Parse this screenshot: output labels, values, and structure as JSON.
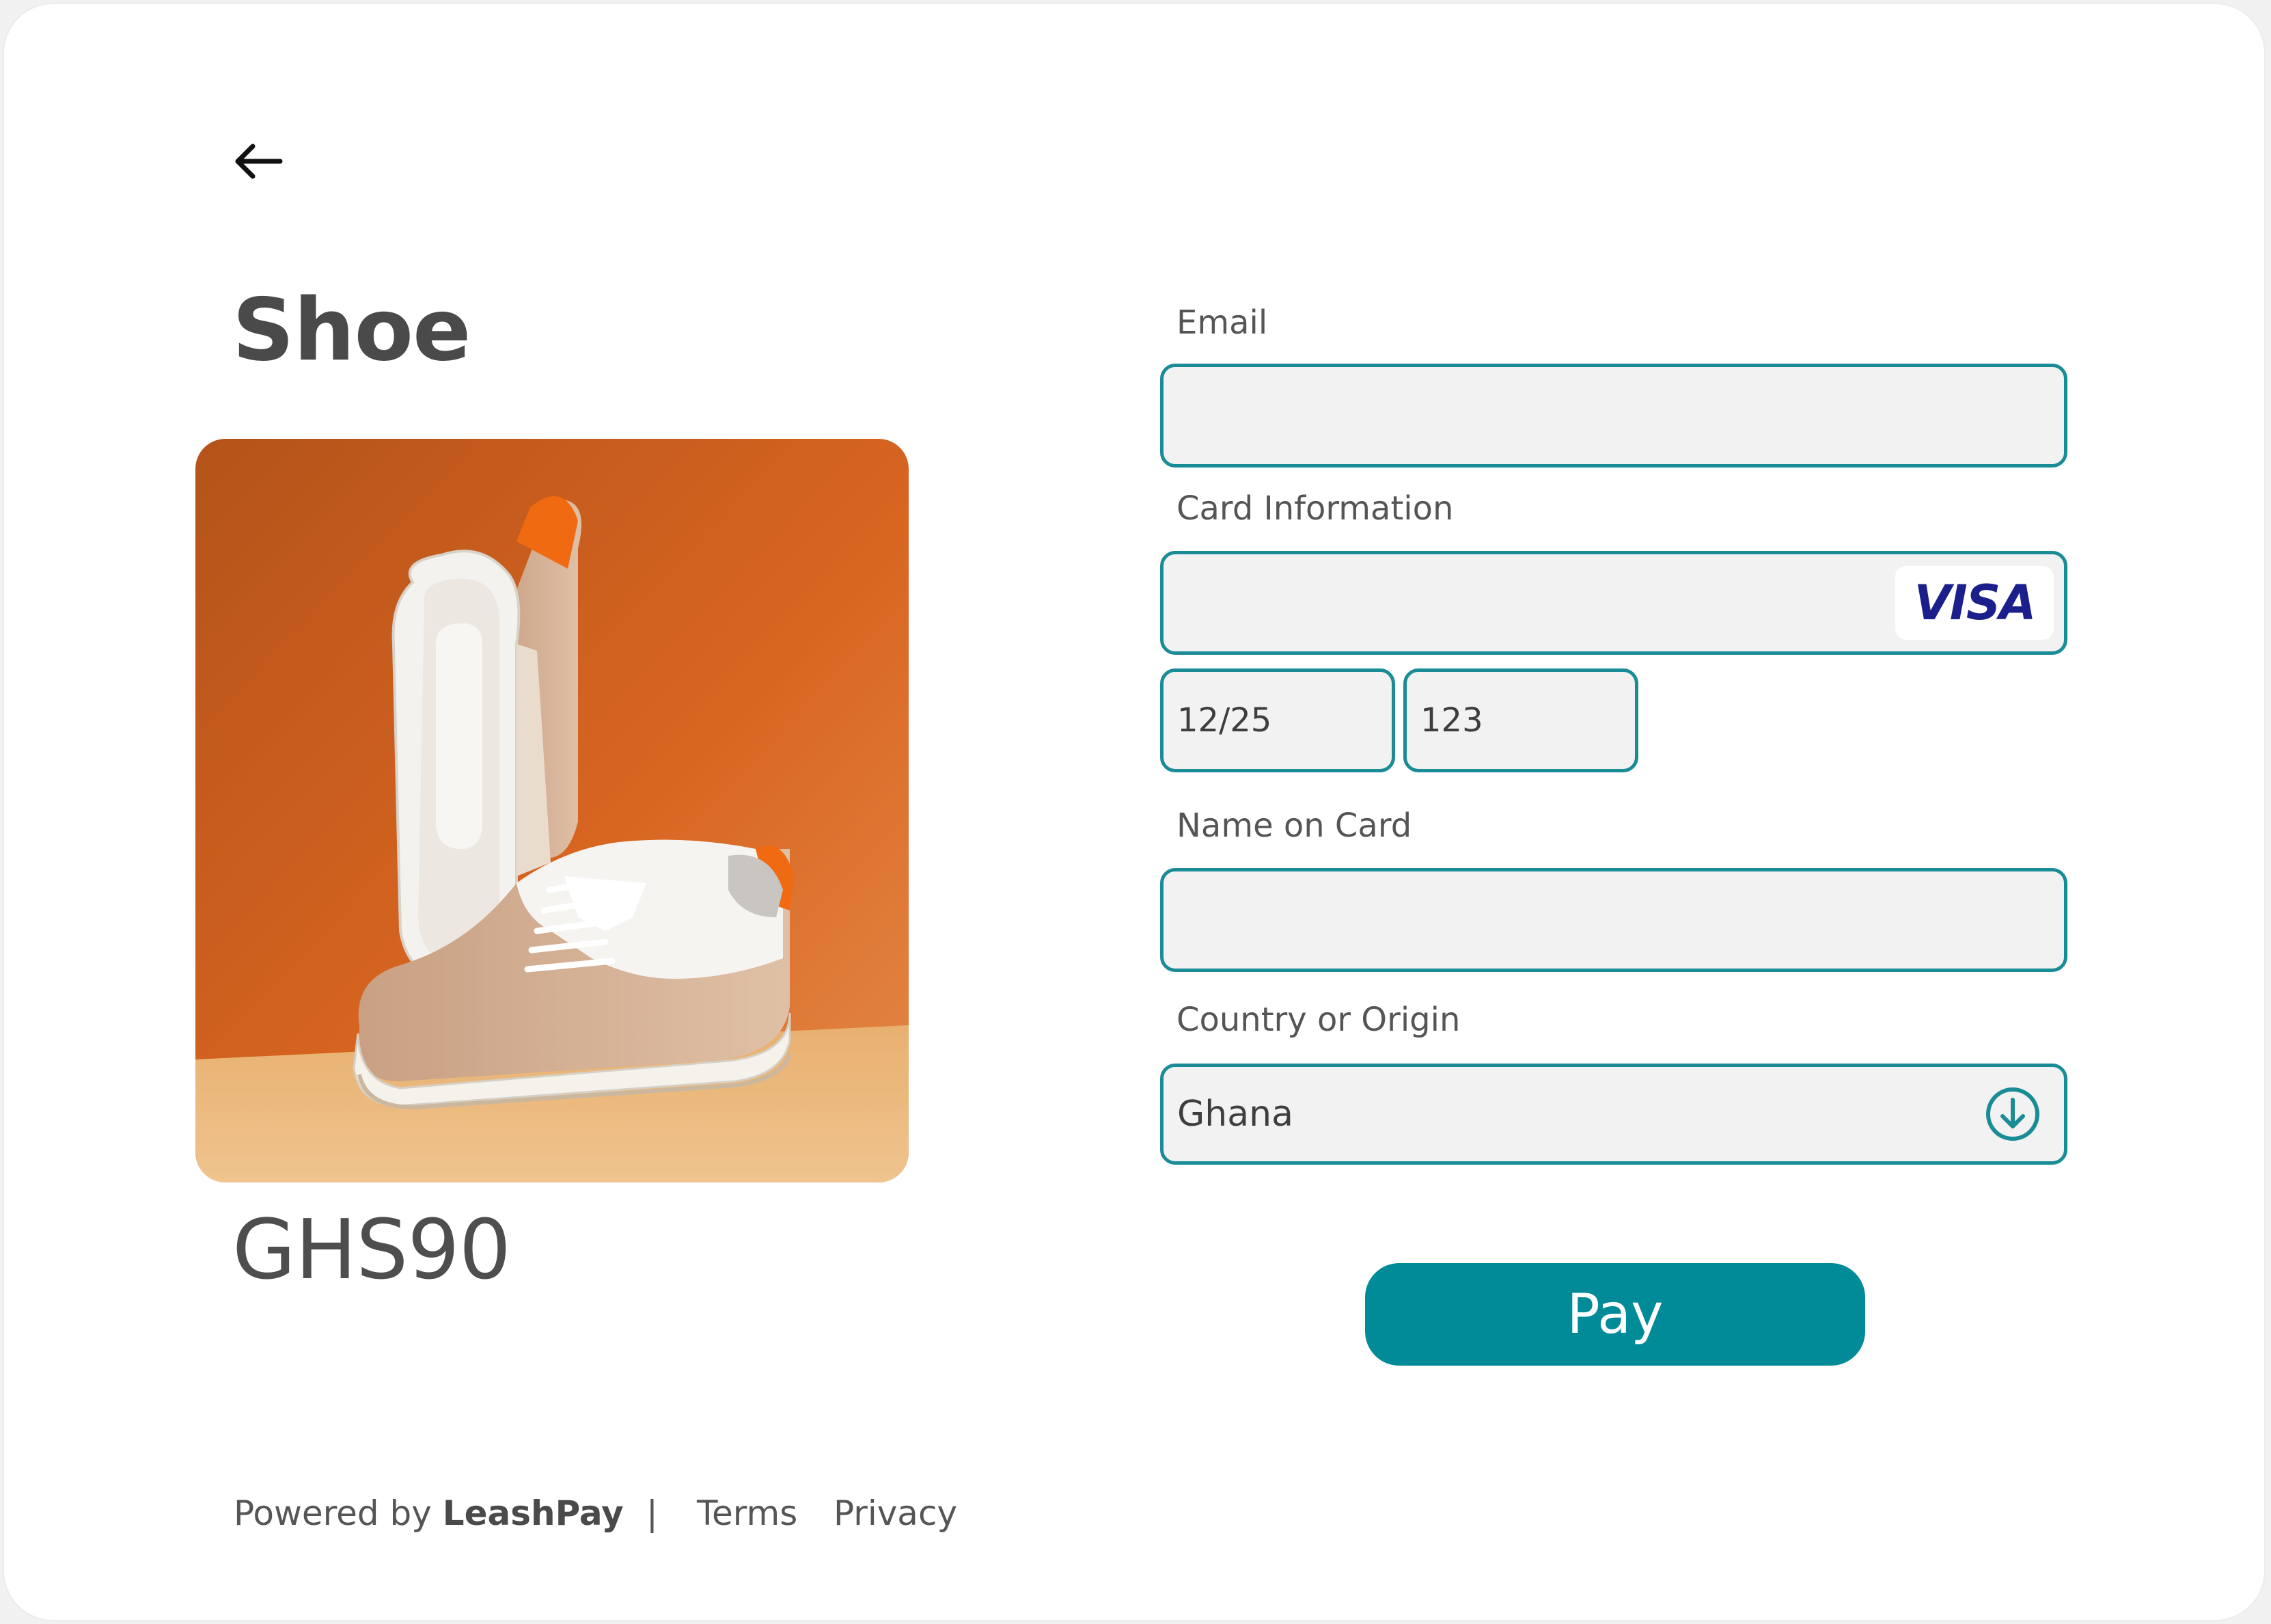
{
  "product": {
    "title": "Shoe",
    "price": "GHS90",
    "image_alt": "Shoe product photo"
  },
  "form": {
    "email_label": "Email",
    "email_value": "",
    "card_label": "Card Information",
    "card_number_value": "",
    "card_brand": "VISA",
    "expiry_value": "12/25",
    "cvc_value": "123",
    "name_label": "Name on Card",
    "name_value": "",
    "country_label": "Country or Origin",
    "country_value": "Ghana",
    "pay_label": "Pay"
  },
  "footer": {
    "powered_by": "Powered by ",
    "brand": "LeashPay",
    "separator": "|",
    "terms": "Terms",
    "privacy": "Privacy"
  },
  "colors": {
    "accent": "#018a98",
    "field_border": "#1a8c96",
    "field_bg": "#f2f2f2",
    "visa_blue": "#1a1f8c"
  },
  "icons": {
    "back": "arrow-left-icon",
    "dropdown": "circle-arrow-down-icon"
  }
}
